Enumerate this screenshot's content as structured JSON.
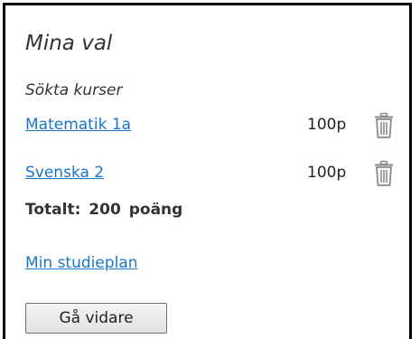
{
  "panel": {
    "title": "Mina val",
    "subtitle": "Sökta kurser",
    "courses": [
      {
        "name": "Matematik 1a",
        "points": "100p",
        "icon": "trash-icon"
      },
      {
        "name": "Svenska 2",
        "points": "100p",
        "icon": "trash-icon"
      }
    ],
    "total_label": "Totalt:",
    "total_value": "200",
    "total_unit": "poäng",
    "plan_link": "Min studieplan",
    "continue_button": "Gå vidare"
  },
  "colors": {
    "link": "#1a75c9",
    "border": "#000000",
    "text": "#333333",
    "icon": "#8a8a8a"
  }
}
